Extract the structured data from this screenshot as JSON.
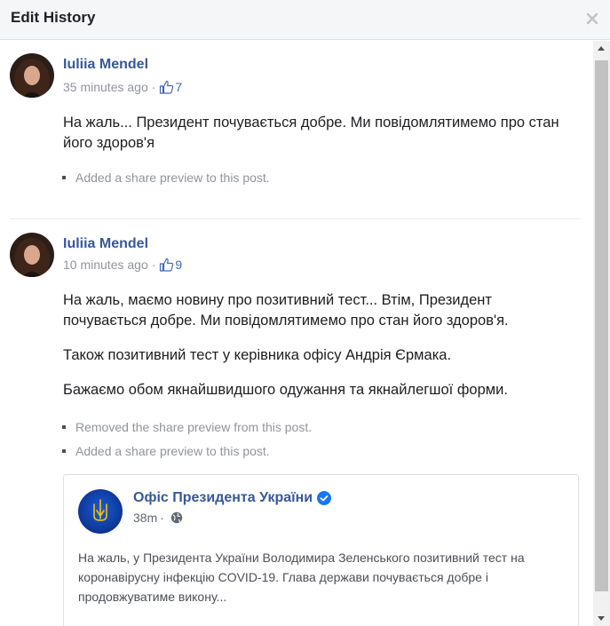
{
  "dialog": {
    "title": "Edit History"
  },
  "entries": [
    {
      "author": "Iuliia Mendel",
      "time": "35 minutes ago",
      "likes": "7",
      "paragraphs": [
        "На жаль... Президент почувається добре. Ми повідомлятимемо про стан його здоров'я"
      ],
      "changes": [
        "Added a share preview to this post."
      ]
    },
    {
      "author": "Iuliia Mendel",
      "time": "10 minutes ago",
      "likes": "9",
      "paragraphs": [
        "На жаль, маємо новину про позитивний тест... Втім, Президент почувається добре. Ми повідомлятимемо про стан його здоров'я.",
        "Також позитивний тест у керівника офісу Андрія Єрмака.",
        "Бажаємо обом якнайшвидшого одужання та якнайлегшої форми."
      ],
      "changes": [
        "Removed the share preview from this post.",
        "Added a share preview to this post."
      ]
    }
  ],
  "share": {
    "page_name": "Офіс Президента України",
    "time": "38m",
    "text": "На жаль, у Президента України Володимира Зеленського позитивний тест на коронавірусну інфекцію COVID-19. Глава держави почувається добре і продовжуватиме викону..."
  },
  "icons": {
    "close": "close-icon",
    "like": "thumbs-up-icon",
    "verified": "verified-badge-icon",
    "globe": "globe-icon",
    "bullet": "bullet-icon"
  },
  "colors": {
    "link": "#385898",
    "meta": "#90949c",
    "like": "#4267b2",
    "verified": "#1877f2",
    "header_bg": "#f5f6f7"
  }
}
